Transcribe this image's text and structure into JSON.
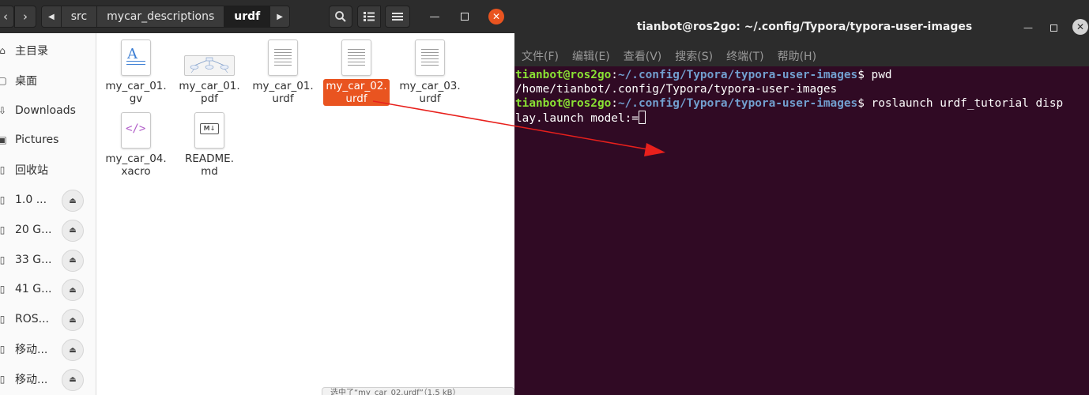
{
  "file_manager": {
    "nav": {
      "back": "‹",
      "forward": "›"
    },
    "breadcrumb": [
      {
        "label": "src"
      },
      {
        "label": "mycar_descriptions"
      },
      {
        "label": "urdf"
      }
    ],
    "sidebar": [
      {
        "label": "主目录",
        "icon": "home-icon"
      },
      {
        "label": "桌面",
        "icon": "folder-icon"
      },
      {
        "label": "Downloads",
        "icon": "download-icon"
      },
      {
        "label": "Pictures",
        "icon": "pictures-icon"
      },
      {
        "label": "回收站",
        "icon": "trash-icon"
      },
      {
        "label": "1.0 ...",
        "icon": "usb-drive-icon"
      },
      {
        "label": "20 G...",
        "icon": "usb-drive-icon"
      },
      {
        "label": "33 G...",
        "icon": "usb-drive-icon"
      },
      {
        "label": "41 G...",
        "icon": "usb-drive-icon"
      },
      {
        "label": "ROS...",
        "icon": "usb-drive-icon"
      },
      {
        "label": "移动...",
        "icon": "usb-drive-icon"
      },
      {
        "label": "移动...",
        "icon": "usb-drive-icon"
      }
    ],
    "files": [
      {
        "name": "my_car_01.\ngv",
        "type": "gv",
        "selected": false
      },
      {
        "name": "my_car_01.\npdf",
        "type": "pdf",
        "selected": false
      },
      {
        "name": "my_car_01.\nurdf",
        "type": "urdf",
        "selected": false
      },
      {
        "name": "my_car_02.\nurdf",
        "type": "urdf",
        "selected": true
      },
      {
        "name": "my_car_03.\nurdf",
        "type": "urdf",
        "selected": false
      },
      {
        "name": "my_car_04.\nxacro",
        "type": "xacro",
        "selected": false
      },
      {
        "name": "README.\nmd",
        "type": "md",
        "selected": false
      }
    ],
    "status": "选中了“my_car_02.urdf”（1.5 kB）",
    "accent_color": "#e95420"
  },
  "terminal": {
    "title": "tianbot@ros2go: ~/.config/Typora/typora-user-images",
    "menu": [
      "文件(F)",
      "编辑(E)",
      "查看(V)",
      "搜索(S)",
      "终端(T)",
      "帮助(H)"
    ],
    "lines": [
      {
        "user": "tianbot@ros2go",
        "path": "~/.config/Typora/typora-user-images",
        "cmd": " pwd"
      },
      {
        "text": "/home/tianbot/.config/Typora/typora-user-images"
      },
      {
        "user": "tianbot@ros2go",
        "path": "~/.config/Typora/typora-user-images",
        "cmd": " roslaunch urdf_tutorial disp"
      },
      {
        "text": "lay.launch model:="
      }
    ],
    "bg_color": "#300a24",
    "prompt_user_color": "#8ae234",
    "prompt_path_color": "#729fcf"
  },
  "annotation": {
    "arrow_color": "#e8201c"
  }
}
